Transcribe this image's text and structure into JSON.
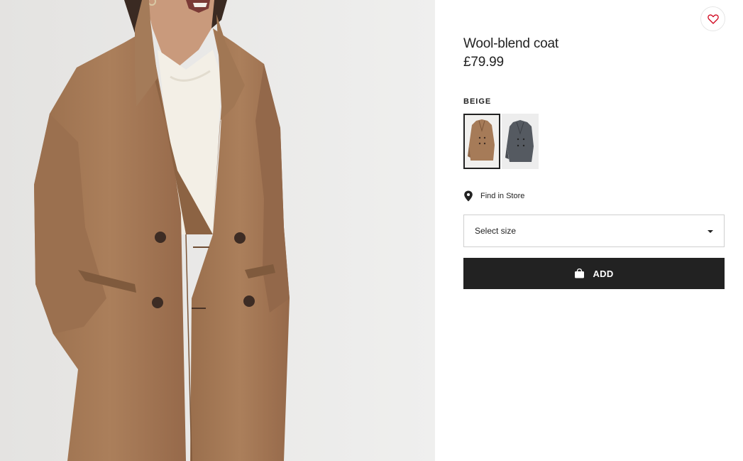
{
  "product": {
    "name": "Wool-blend coat",
    "price": "£79.99"
  },
  "color": {
    "selected_label": "BEIGE",
    "swatches": [
      {
        "name": "beige",
        "color": "#a67b58",
        "selected": true
      },
      {
        "name": "dark-grey",
        "color": "#555a61",
        "selected": false
      }
    ]
  },
  "store": {
    "label": "Find in Store",
    "icon": "map-pin-icon"
  },
  "size": {
    "placeholder": "Select size",
    "icon": "caret-down-icon"
  },
  "cart": {
    "add_label": "ADD",
    "icon": "shopping-bag-icon"
  },
  "favorite": {
    "icon": "heart-icon",
    "color": "#d0021b"
  },
  "colors": {
    "primary": "#222222",
    "coat": "#a67b58",
    "background": "#ebebea"
  }
}
